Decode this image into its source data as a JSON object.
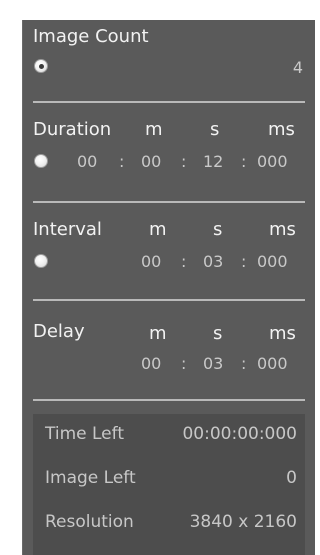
{
  "image_count": {
    "title": "Image Count",
    "value": "4",
    "selected": true
  },
  "duration": {
    "title": "Duration",
    "units": [
      "m",
      "s",
      "ms"
    ],
    "minutes": "00",
    "seconds": "12",
    "milliseconds": "000",
    "selected": false
  },
  "interval": {
    "title": "Interval",
    "units": [
      "m",
      "s",
      "ms"
    ],
    "minutes": "00",
    "seconds": "03",
    "milliseconds": "000",
    "selected": false
  },
  "delay": {
    "title": "Delay",
    "units": [
      "m",
      "s",
      "ms"
    ],
    "minutes": "00",
    "seconds": "03",
    "milliseconds": "000"
  },
  "separator": ":",
  "info": {
    "time_left_label": "Time Left",
    "time_left_value": "00:00:00:000",
    "image_left_label": "Image Left",
    "image_left_value": "0",
    "resolution_label": "Resolution",
    "resolution_value": "3840 x 2160"
  },
  "colors": {
    "panel_bg": "#5a5a5a",
    "info_bg": "#4d4d4d",
    "divider": "#b9b9b9",
    "text_primary": "#f2f2f2",
    "text_secondary": "#c9c9c9"
  }
}
